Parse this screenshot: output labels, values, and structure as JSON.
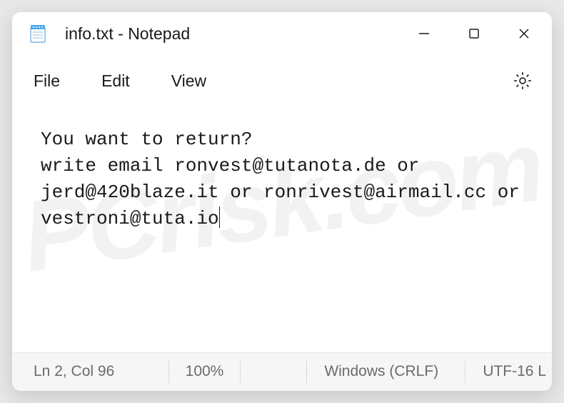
{
  "window": {
    "title": "info.txt - Notepad"
  },
  "menu": {
    "file": "File",
    "edit": "Edit",
    "view": "View"
  },
  "content": {
    "text": "You want to return?\nwrite email ronvest@tutanota.de or jerd@420blaze.it or ronrivest@airmail.cc or vestroni@tuta.io"
  },
  "status": {
    "cursor": "Ln 2, Col 96",
    "zoom": "100%",
    "eol": "Windows (CRLF)",
    "encoding": "UTF-16 L"
  }
}
